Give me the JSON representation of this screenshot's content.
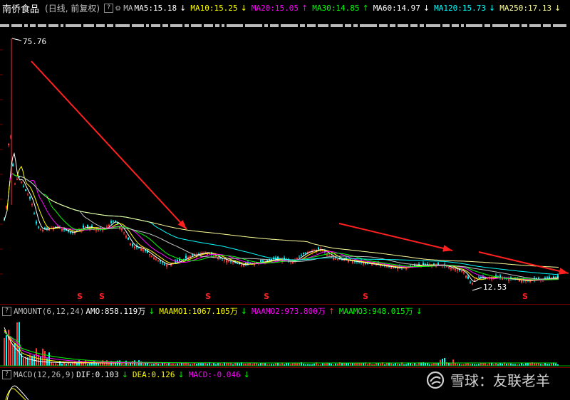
{
  "header": {
    "stock_name": "南侨食品",
    "subtitle": "(日线, 前复权)",
    "help_glyph": "?",
    "ma_label": "MA",
    "ma_values": [
      {
        "label": "MA5:15.18",
        "arrow": "↓",
        "color": "#ffffff",
        "arrow_color": "#ffffff"
      },
      {
        "label": "MA10:15.25",
        "arrow": "↓",
        "color": "#ffff00",
        "arrow_color": "#ffff00"
      },
      {
        "label": "MA20:15.05",
        "arrow": "↑",
        "color": "#ff00ff",
        "arrow_color": "#ff00ff"
      },
      {
        "label": "MA30:14.85",
        "arrow": "↑",
        "color": "#00ff00",
        "arrow_color": "#00ff00"
      },
      {
        "label": "MA60:14.97",
        "arrow": "↓",
        "color": "#ffffff",
        "arrow_color": "#ffffff"
      },
      {
        "label": "MA120:15.73",
        "arrow": "↓",
        "color": "#00ffff",
        "arrow_color": "#00ffff"
      },
      {
        "label": "MA250:17.13",
        "arrow": "↓",
        "color": "#ffff99",
        "arrow_color": "#ffff99"
      }
    ]
  },
  "amount_panel": {
    "label": "AMOUNT(6,12,24)",
    "values": [
      {
        "label": "AMO:858.119万",
        "arrow": "↓",
        "color": "#ffffff"
      },
      {
        "label": "MAAMO1:1067.105万",
        "arrow": "↓",
        "color": "#ffff00"
      },
      {
        "label": "MAAMO2:973.800万",
        "arrow": "↑",
        "color": "#ff00ff"
      },
      {
        "label": "MAAMO3:948.015万",
        "arrow": "↓",
        "color": "#00ff00"
      }
    ]
  },
  "macd_panel": {
    "label": "MACD(12,26,9)",
    "values": [
      {
        "label": "DIF:0.103",
        "arrow": "↓",
        "color": "#ffffff"
      },
      {
        "label": "DEA:0.126",
        "arrow": "↓",
        "color": "#ffff00"
      },
      {
        "label": "MACD:-0.046",
        "arrow": "↓",
        "color": "#ff00ff"
      }
    ]
  },
  "watermark": "雪球：友联老羊",
  "colors": {
    "up": "#ff3232",
    "down": "#00ffff",
    "ma5": "#ffffff",
    "ma10": "#ffff00",
    "ma20": "#ff00ff",
    "ma30": "#00ff00",
    "ma60": "#c0c0c0",
    "ma120": "#00ffff",
    "ma250": "#ffff99",
    "arrow": "#ff2020",
    "s_marker": "#ff2020"
  },
  "chart_data": {
    "type": "candlestick",
    "price_high_label": "75.76",
    "price_low_label": "12.53",
    "price_high": 75.76,
    "price_low": 12.53,
    "s_markers": [
      "S",
      "S",
      "S",
      "S",
      "S",
      "S"
    ],
    "trend_arrows": 3
  }
}
